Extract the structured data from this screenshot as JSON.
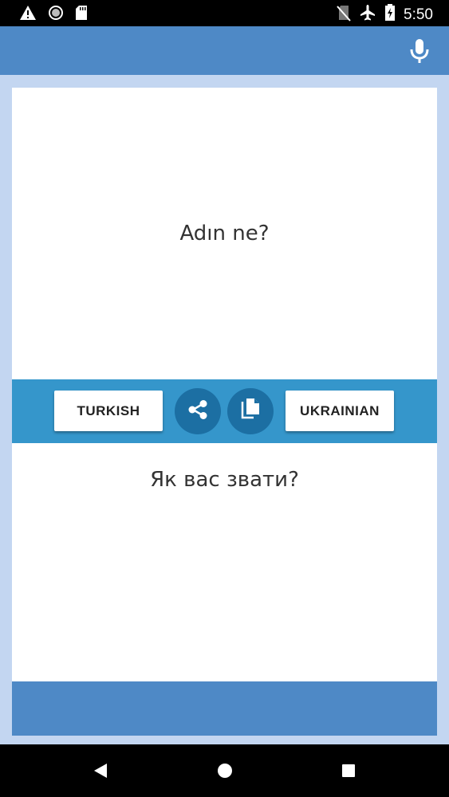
{
  "status_bar": {
    "time": "5:50",
    "icons": [
      "warning-icon",
      "sync-circle-icon",
      "sd-card-icon",
      "no-sim-icon",
      "airplane-icon",
      "battery-charging-icon"
    ]
  },
  "app_bar": {
    "mic_icon": "microphone-icon",
    "color": "#4e89c6"
  },
  "translation": {
    "source_text": "Adın ne?",
    "target_text": "Як вас звати?"
  },
  "toolbar": {
    "source_language": "TURKISH",
    "target_language": "UKRAINIAN",
    "share_icon": "share-icon",
    "copy_icon": "copy-icon",
    "color": "#3596cb"
  },
  "nav_bar": {
    "icons": [
      "back-icon",
      "home-icon",
      "recents-icon"
    ]
  }
}
